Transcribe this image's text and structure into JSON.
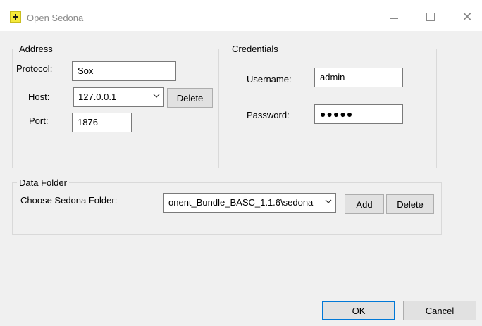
{
  "window": {
    "title": "Open Sedona",
    "close_glyph": "✕"
  },
  "address": {
    "legend": "Address",
    "protocol_label": "Protocol:",
    "protocol_value": "Sox",
    "host_label": "Host:",
    "host_value": "127.0.0.1",
    "delete_label": "Delete",
    "port_label": "Port:",
    "port_value": "1876"
  },
  "credentials": {
    "legend": "Credentials",
    "username_label": "Username:",
    "username_value": "admin",
    "password_label": "Password:",
    "password_value": "●●●●●"
  },
  "data_folder": {
    "legend": "Data Folder",
    "choose_label": "Choose Sedona Folder:",
    "folder_value": "onent_Bundle_BASC_1.1.6\\sedona",
    "add_label": "Add",
    "delete_label": "Delete"
  },
  "footer": {
    "ok_label": "OK",
    "cancel_label": "Cancel"
  },
  "icons": {
    "app": "plus-icon",
    "dropdown": "chevron-down-icon"
  },
  "colors": {
    "app_icon": "#f5e93a",
    "default_button_border": "#0078d7",
    "dialog_background": "#f0f0f0"
  }
}
